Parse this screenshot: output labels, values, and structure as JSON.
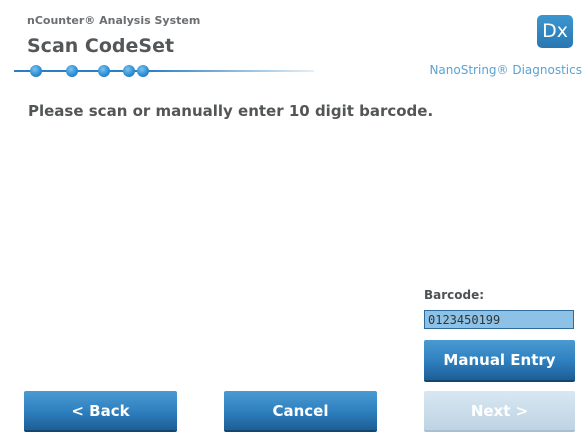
{
  "header": {
    "app_subtitle": "nCounter® Analysis System",
    "page_title": "Scan CodeSet",
    "brand": "NanoString® Diagnostics",
    "logo_text": "Dx",
    "progress_steps": 5,
    "accent_color": "#2f86c8"
  },
  "main": {
    "instruction": "Please scan or manually enter 10 digit barcode."
  },
  "barcode": {
    "label": "Barcode:",
    "value": "0123450199"
  },
  "buttons": {
    "manual_entry": "Manual Entry",
    "back": "< Back",
    "cancel": "Cancel",
    "next": "Next >",
    "next_enabled": false
  }
}
